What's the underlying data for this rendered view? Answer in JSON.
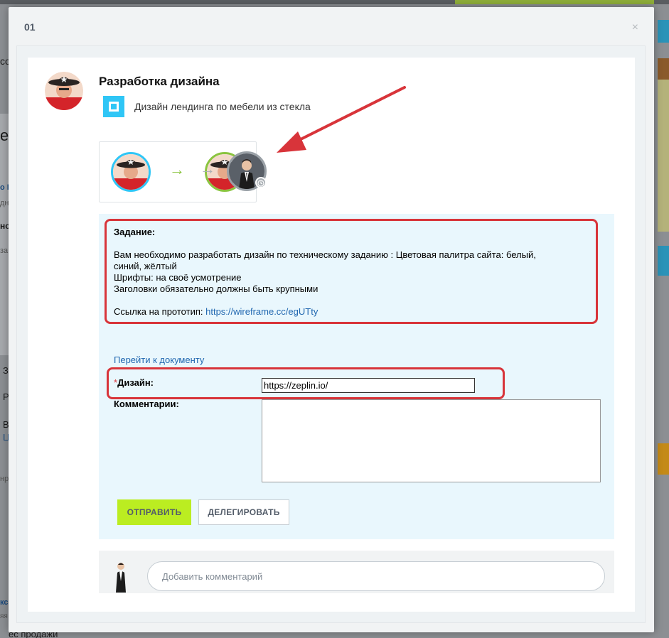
{
  "modal": {
    "header_title": "01",
    "close_glyph": "×"
  },
  "task": {
    "title": "Разработка дизайна",
    "subtitle": "Дизайн лендинга по мебели из стекла"
  },
  "flow": {
    "arrow_glyph": "→",
    "completed_color": "#8ac43f",
    "pending_color": "#9aa1a7"
  },
  "form": {
    "assignment_label": "Задание:",
    "assignment_line1": "Вам необходимо разработать дизайн по техническому заданию : Цветовая палитра сайта: белый,",
    "assignment_line2": "синий, жёлтый",
    "assignment_line3": "Шрифты: на своё усмотрение",
    "assignment_line4": "Заголовки обязательно должны быть крупными",
    "prototype_label": "Ссылка на прототип: ",
    "prototype_link": "https://wireframe.cc/egUTty",
    "goto_document": "Перейти к документу",
    "required_mark": "*",
    "design_label": "Дизайн:",
    "design_value": "https://zeplin.io/",
    "comments_label": "Комментарии:",
    "send_button": "ОТПРАВИТЬ",
    "delegate_button": "ДЕЛЕГИРОВАТЬ"
  },
  "comment": {
    "placeholder": "Добавить комментарий"
  },
  "background": {
    "frag1": "co",
    "frag2": "e",
    "frag3": "о Б",
    "frag4": "дн",
    "frag5": "нс",
    "frag6": "за",
    "frag7": "З",
    "frag8": "Р",
    "frag9": "В",
    "frag10": "Ц",
    "frag11": "нр",
    "frag12": "кс",
    "frag13": "яя",
    "frag14": "ес продажи"
  }
}
